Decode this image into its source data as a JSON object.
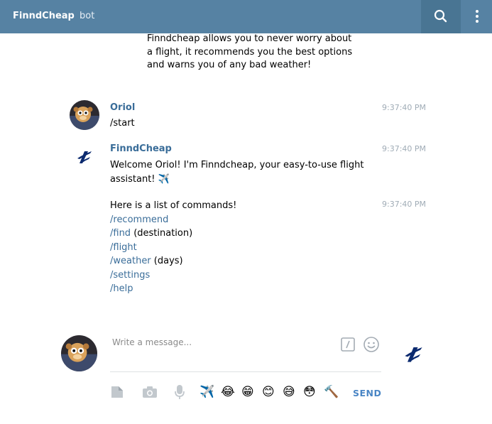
{
  "header": {
    "title": "FinndCheap",
    "subtitle": "bot"
  },
  "intro_text": "Finndcheap allows you to never worry about a flight, it recommends you the best options and warns you of any bad weather!",
  "messages": [
    {
      "sender": "Oriol",
      "time": "9:37:40 PM",
      "text": "/start"
    },
    {
      "sender": "FinndCheap",
      "time": "9:37:40 PM",
      "text": "Welcome Oriol! I'm Finndcheap, your easy-to-use flight assistant! ✈️"
    },
    {
      "time": "9:37:40 PM",
      "intro": "Here is a list of commands!",
      "commands": [
        {
          "command": "/recommend",
          "arg": ""
        },
        {
          "command": "/find",
          "arg": " (destination)"
        },
        {
          "command": "/flight",
          "arg": ""
        },
        {
          "command": "/weather",
          "arg": " (days)"
        },
        {
          "command": "/settings",
          "arg": ""
        },
        {
          "command": "/help",
          "arg": ""
        }
      ]
    }
  ],
  "composer": {
    "placeholder": "Write a message...",
    "send_label": "SEND",
    "emojis": [
      "✈️",
      "😂",
      "😁",
      "😊",
      "😅",
      "😳",
      "🔨"
    ]
  },
  "colors": {
    "header_bg": "#5682a3",
    "link": "#3a6d99",
    "timestamp": "#a0acb6",
    "send": "#4a86c5"
  },
  "icons": [
    "search-icon",
    "more-vert-icon",
    "slash-commands-icon",
    "emoji-icon",
    "document-icon",
    "camera-icon",
    "microphone-icon"
  ]
}
